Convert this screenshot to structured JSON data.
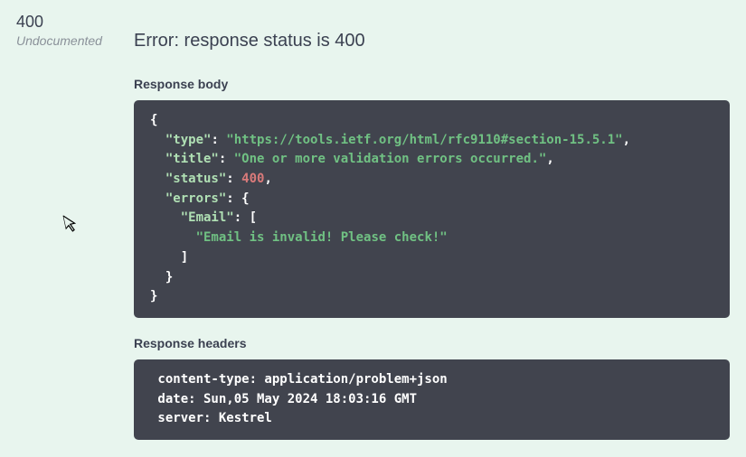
{
  "status": {
    "code": "400",
    "label": "Undocumented"
  },
  "error_title": "Error: response status is 400",
  "response_body": {
    "section_title": "Response body",
    "json": {
      "type_key": "\"type\"",
      "type_val": "\"https://tools.ietf.org/html/rfc9110#section-15.5.1\"",
      "title_key": "\"title\"",
      "title_val": "\"One or more validation errors occurred.\"",
      "status_key": "\"status\"",
      "status_val": "400",
      "errors_key": "\"errors\"",
      "email_key": "\"Email\"",
      "email_msg": "\"Email is invalid! Please check!\"",
      "brace_open": "{",
      "brace_close": "}",
      "bracket_open": "[",
      "bracket_close": "]",
      "colon_sp": ": ",
      "comma": ","
    }
  },
  "response_headers": {
    "section_title": "Response headers",
    "line1": " content-type: application/problem+json ",
    "line2": " date: Sun,05 May 2024 18:03:16 GMT ",
    "line3": " server: Kestrel "
  }
}
